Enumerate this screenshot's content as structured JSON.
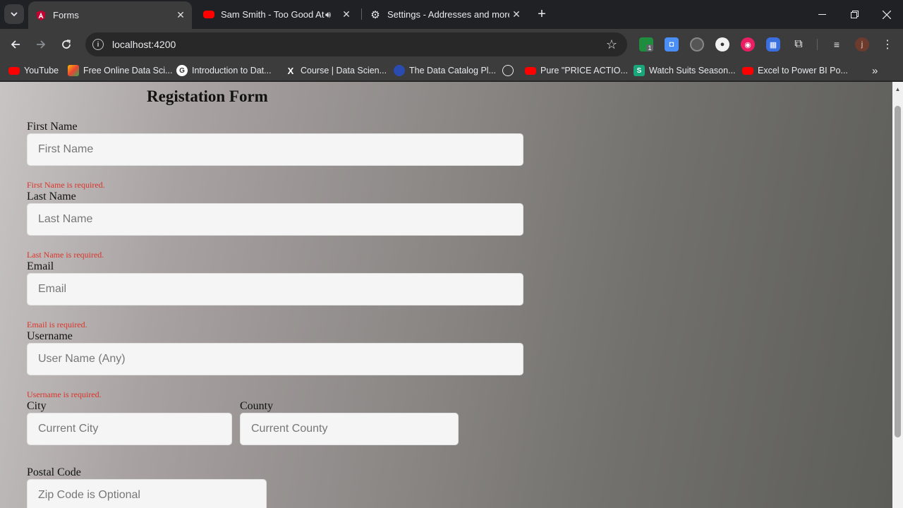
{
  "browser": {
    "tabs": [
      {
        "title": "Forms",
        "active": true
      },
      {
        "title": "Sam Smith - Too Good At G",
        "audio": true
      },
      {
        "title": "Settings - Addresses and more"
      }
    ],
    "url": "localhost:4200",
    "profile_initial": "j",
    "extension_badge": "1",
    "bookmarks": [
      "YouTube",
      "Free Online Data Sci...",
      "Introduction to Dat...",
      "Course | Data Scien...",
      "The Data Catalog Pl...",
      "",
      "Pure \"PRICE ACTIO...",
      "Watch Suits Season...",
      "Excel to Power BI Po..."
    ]
  },
  "form": {
    "title": "Registation Form",
    "first_name": {
      "label": "First Name",
      "placeholder": "First Name",
      "error": "First Name is required."
    },
    "last_name": {
      "label": "Last Name",
      "placeholder": "Last Name",
      "error": "Last Name is required."
    },
    "email": {
      "label": "Email",
      "placeholder": "Email",
      "error": "Email is required."
    },
    "username": {
      "label": "Username",
      "placeholder": "User Name (Any)",
      "error": "Username is required."
    },
    "city": {
      "label": "City",
      "placeholder": "Current City"
    },
    "county": {
      "label": "County",
      "placeholder": "Current County"
    },
    "postal_code": {
      "label": "Postal Code",
      "placeholder": "Zip Code is Optional"
    }
  }
}
